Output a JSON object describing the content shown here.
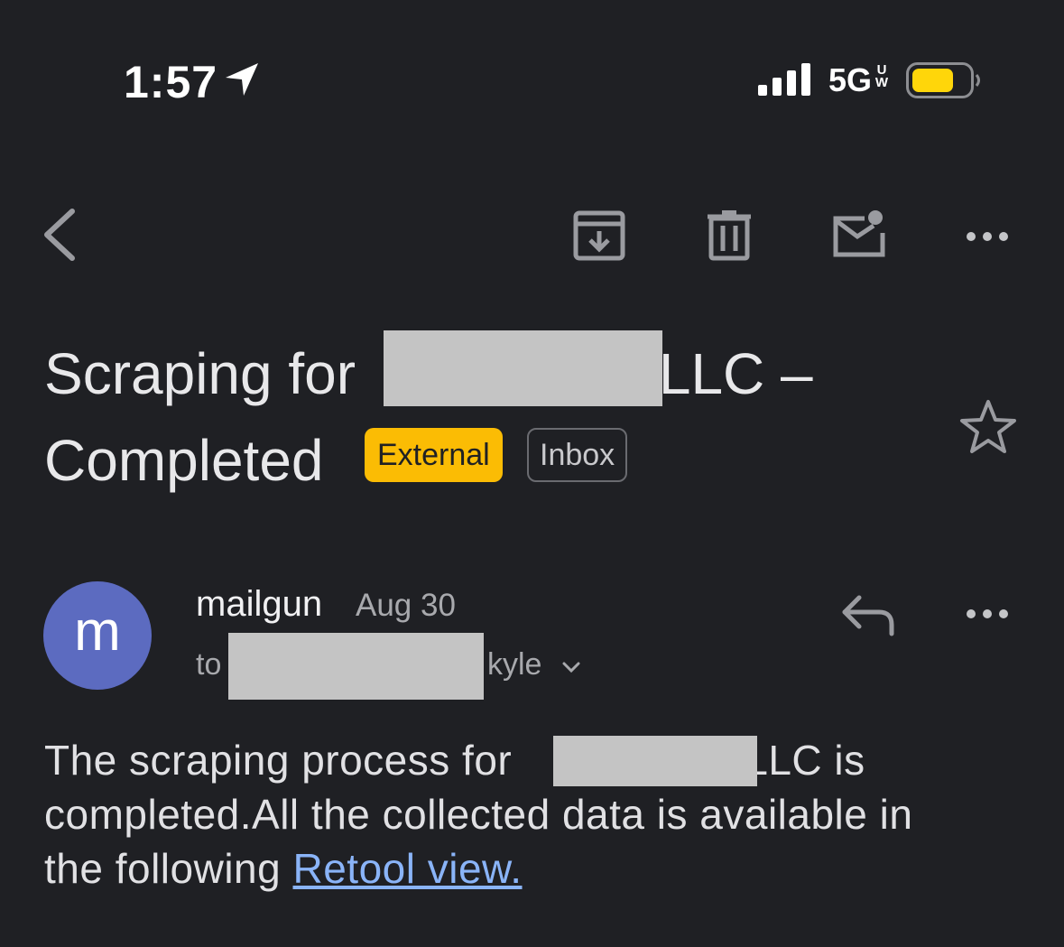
{
  "status_bar": {
    "time": "1:57",
    "network": "5G",
    "network_badge_top": "U",
    "network_badge_bottom": "W",
    "battery_color": "#ffd60a",
    "icons": [
      "location-arrow-icon",
      "signal-icon",
      "battery-icon"
    ]
  },
  "toolbar": {
    "icons": [
      "back-icon",
      "archive-icon",
      "trash-icon",
      "mark-unread-icon",
      "more-icon"
    ]
  },
  "email": {
    "subject_part1": "Scraping for ",
    "subject_part2": "LLC –",
    "subject_part3": "Completed",
    "labels": {
      "external": "External",
      "inbox": "Inbox"
    },
    "sender": {
      "avatar_letter": "m",
      "name": "mailgun",
      "date": "Aug 30",
      "to_prefix": "to",
      "to_name": "kyle"
    },
    "body": {
      "part1": "The scraping process for",
      "part2": "LLC is",
      "part3": "completed.All the collected data is available in",
      "part4": "the following ",
      "link_text": "Retool view. "
    }
  },
  "colors": {
    "background": "#1f2024",
    "external_badge": "#fbbc04",
    "avatar": "#5c6bc0",
    "link": "#8ab4f8",
    "redaction": "#c4c4c4"
  }
}
